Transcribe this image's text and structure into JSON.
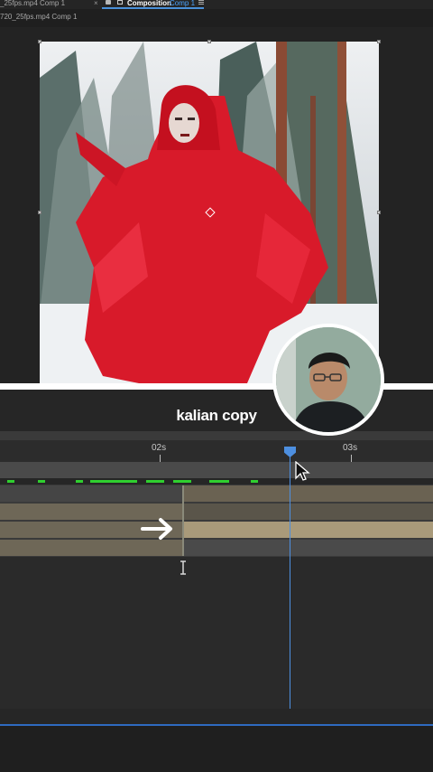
{
  "tabs": {
    "footage_tab": "_25fps.mp4 Comp 1",
    "close_glyph": "×",
    "comp_tab_label": "Composition",
    "comp_tab_name": "Comp 1"
  },
  "breadcrumb": "720_25fps.mp4 Comp 1",
  "caption": "kalian copy",
  "timeline": {
    "tick_1": "02s",
    "tick_2": "03s"
  },
  "colors": {
    "accent": "#4d8fe0",
    "cache_green": "#2fcf2f",
    "layer_tan": "#7a705e"
  },
  "icons": [
    "lock-icon",
    "camera-icon",
    "panel-menu-icon",
    "anchor-point-icon",
    "mouse-pointer-icon",
    "arrow-right-icon",
    "text-cursor-icon"
  ]
}
